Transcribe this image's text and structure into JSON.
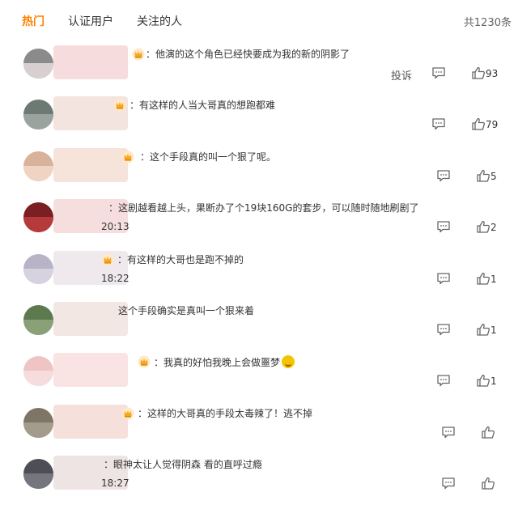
{
  "tabs": [
    {
      "label": "热门",
      "active": true
    },
    {
      "label": "认证用户",
      "active": false
    },
    {
      "label": "关注的人",
      "active": false
    }
  ],
  "total": "共1230条",
  "accent_color": "#ff8200",
  "report_label": "投诉",
  "icons": [
    "crown-icon",
    "comment-icon",
    "thumbs-up-icon",
    "laughing-emoji-icon"
  ],
  "comments": [
    {
      "text": "：他演的这个角色已经快要成为我的新的阴影了",
      "time": "",
      "likes": "93",
      "avatar": [
        "#8b8b8b",
        "#d8d0d0"
      ],
      "blur": "#f6dcdc"
    },
    {
      "text": "：有这样的人当大哥真的想跑都难",
      "time": "",
      "likes": "79",
      "avatar": [
        "#6d7a73",
        "#9aa39e"
      ],
      "blur": "#f4e4e0"
    },
    {
      "text": "：这个手段真的叫一个狠了呢。",
      "time": "",
      "likes": "5",
      "avatar": [
        "#d8b29a",
        "#f0d3c2"
      ],
      "blur": "#f6e3d9"
    },
    {
      "text": "：这剧越看越上头，果断办了个19块160G的套步，可以随时随地刷剧了",
      "time": "20:13",
      "likes": "2",
      "avatar": [
        "#7a1f24",
        "#b63a3a"
      ],
      "blur": "#f7dede"
    },
    {
      "text": "：有这样的大哥也是跑不掉的",
      "time": "18:22",
      "likes": "1",
      "avatar": [
        "#b8b3c6",
        "#d6d2df"
      ],
      "blur": "#efe9ee"
    },
    {
      "text": "这个手段确实是真叫一个狠来着",
      "time": "",
      "likes": "1",
      "avatar": [
        "#5d7a4e",
        "#8aa178"
      ],
      "blur": "#f3e7e4"
    },
    {
      "text": "：我真的好怕我晚上会做噩梦",
      "time": "",
      "likes": "1",
      "avatar": [
        "#eec4c4",
        "#f6dcdc"
      ],
      "blur": "#f9e3e3"
    },
    {
      "text": "：这样的大哥真的手段太毒辣了！逃不掉",
      "time": "",
      "likes": "",
      "avatar": [
        "#7e7566",
        "#a39b8c"
      ],
      "blur": "#f5e0dc"
    },
    {
      "text": "：眼神太让人觉得阴森 看的直呼过瘾",
      "time": "18:27",
      "likes": "",
      "avatar": [
        "#4e4e56",
        "#75757d"
      ],
      "blur": "#efe4e4"
    }
  ]
}
